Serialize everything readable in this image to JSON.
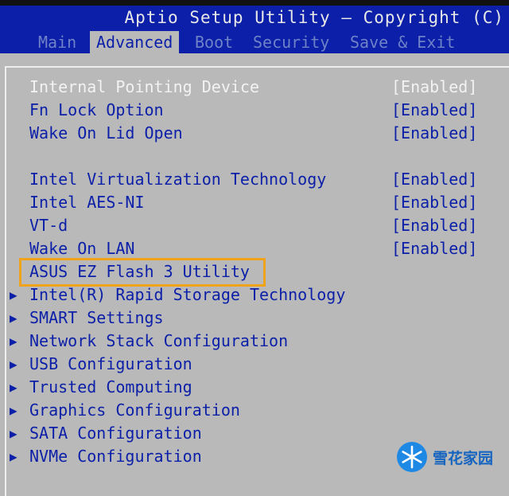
{
  "header": {
    "title": "Aptio Setup Utility – Copyright (C)",
    "tabs": [
      {
        "label": "Main"
      },
      {
        "label": "Advanced",
        "active": true
      },
      {
        "label": "Boot"
      },
      {
        "label": "Security"
      },
      {
        "label": "Save & Exit"
      }
    ]
  },
  "settings": [
    {
      "label": "Internal Pointing Device",
      "value": "[Enabled]"
    },
    {
      "label": "Fn Lock Option",
      "value": "[Enabled]"
    },
    {
      "label": "Wake On Lid Open",
      "value": "[Enabled]"
    },
    {
      "label": "Intel Virtualization Technology",
      "value": "[Enabled]"
    },
    {
      "label": "Intel AES-NI",
      "value": "[Enabled]"
    },
    {
      "label": "VT-d",
      "value": "[Enabled]"
    },
    {
      "label": "Wake On LAN",
      "value": "[Enabled]"
    }
  ],
  "highlighted_item": {
    "label": "ASUS EZ Flash 3 Utility"
  },
  "submenus": [
    {
      "label": "Intel(R) Rapid Storage Technology"
    },
    {
      "label": "SMART Settings"
    },
    {
      "label": "Network Stack Configuration"
    },
    {
      "label": "USB Configuration"
    },
    {
      "label": "Trusted Computing"
    },
    {
      "label": "Graphics Configuration"
    },
    {
      "label": "SATA Configuration"
    },
    {
      "label": "NVMe Configuration"
    }
  ],
  "watermark": {
    "text": "雪花家园"
  },
  "colors": {
    "header": "#0b1fa8",
    "panel": "#b9b9b9",
    "highlight": "#f0a21a",
    "inactive_tab": "#6f82c8"
  }
}
